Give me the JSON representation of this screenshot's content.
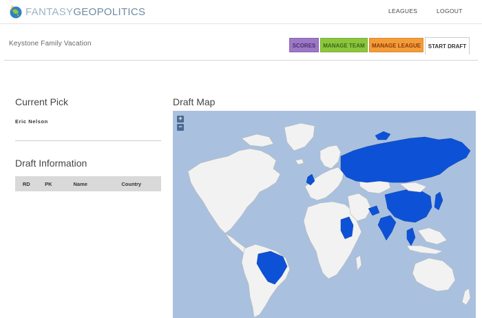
{
  "header": {
    "logo_light": "FANTASY",
    "logo_bold": "GEOPOLITICS",
    "nav": {
      "leagues": "LEAGUES",
      "logout": "LOGOUT"
    }
  },
  "league": {
    "name": "Keystone Family Vacation",
    "buttons": {
      "scores": "SCORES",
      "manage_team": "MANAGE TEAM",
      "manage_league": "MANAGE LEAGUE",
      "start_draft": "START DRAFT"
    }
  },
  "current_pick": {
    "title": "Current Pick",
    "name": "Eric Nelson"
  },
  "draft_info": {
    "title": "Draft Information",
    "columns": [
      "RD",
      "PK",
      "Name",
      "Country"
    ]
  },
  "draft_map": {
    "title": "Draft Map",
    "zoom_in": "+",
    "zoom_out": "−",
    "colors": {
      "ocean": "#a9c1de",
      "land": "#f2f2f2",
      "selected": "#0d52d6",
      "border": "#b7b7b7"
    }
  }
}
